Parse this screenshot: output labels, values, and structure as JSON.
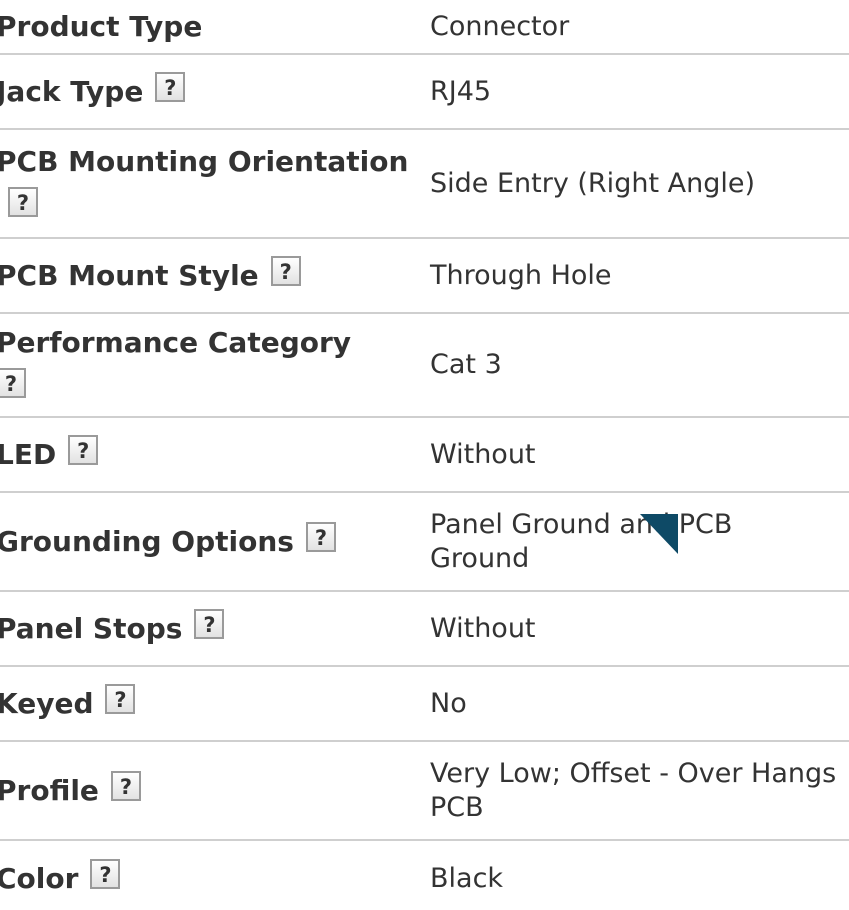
{
  "specs": [
    {
      "label": "Product Type",
      "value": "Connector",
      "help": false
    },
    {
      "label": "Jack Type",
      "value": "RJ45",
      "help": true,
      "help_label": "?"
    },
    {
      "label": "PCB Mounting Orientation",
      "value": "Side Entry (Right Angle)",
      "help": true,
      "help_label": "?"
    },
    {
      "label": "PCB Mount Style",
      "value": "Through Hole",
      "help": true,
      "help_label": "?"
    },
    {
      "label": "Performance Category",
      "value": "Cat 3",
      "help": true,
      "help_label": "?"
    },
    {
      "label": "LED",
      "value": "Without",
      "help": true,
      "help_label": "?"
    },
    {
      "label": "Grounding Options",
      "value": "Panel Ground and PCB Ground",
      "help": true,
      "help_label": "?"
    },
    {
      "label": "Panel Stops",
      "value": "Without",
      "help": true,
      "help_label": "?"
    },
    {
      "label": "Keyed",
      "value": "No",
      "help": true,
      "help_label": "?"
    },
    {
      "label": "Profile",
      "value": "Very Low; Offset - Over Hangs PCB",
      "help": true,
      "help_label": "?"
    },
    {
      "label": "Color",
      "value": "Black",
      "help": true,
      "help_label": "?"
    }
  ],
  "colors": {
    "text": "#333333",
    "divider": "#cfcfcf",
    "cursor": "#0e4a66"
  },
  "cursor_icon": "mouse-pointer-icon"
}
